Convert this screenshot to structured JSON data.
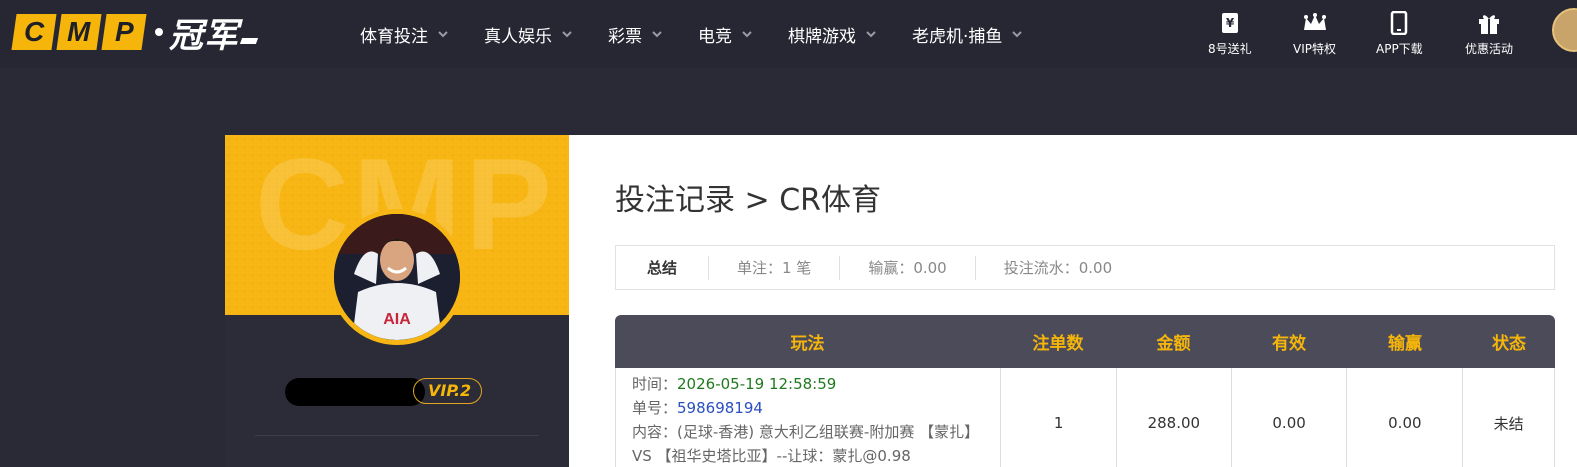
{
  "header": {
    "logo_letters": [
      "C",
      "M",
      "P"
    ],
    "logo_cn": "冠军",
    "nav": [
      {
        "label": "体育投注"
      },
      {
        "label": "真人娱乐"
      },
      {
        "label": "彩票"
      },
      {
        "label": "电竞"
      },
      {
        "label": "棋牌游戏"
      },
      {
        "label": "老虎机·捕鱼"
      }
    ],
    "quick_links": [
      {
        "label": "8号送礼",
        "icon": "yen-gift-icon"
      },
      {
        "label": "VIP特权",
        "icon": "crown-icon"
      },
      {
        "label": "APP下载",
        "icon": "phone-icon"
      },
      {
        "label": "优惠活动",
        "icon": "gift-box-icon"
      }
    ]
  },
  "profile": {
    "watermark": "CMP",
    "vip_label": "VIP.2"
  },
  "page": {
    "title": "投注记录 > CR体育"
  },
  "summary": {
    "label": "总结",
    "single": "单注：1 笔",
    "winloss": "输赢：0.00",
    "turnover": "投注流水：0.00"
  },
  "table": {
    "headers": [
      "玩法",
      "注单数",
      "金额",
      "有效",
      "输赢",
      "状态"
    ],
    "rows": [
      {
        "time_label": "时间：",
        "time": "2026-05-19 12:58:59",
        "order_label": "单号：",
        "order": "598698194",
        "content_label": "内容：",
        "content": "(足球-香港) 意大利乙组联赛-附加赛 【蒙扎】 VS 【祖华史塔比亚】--让球：蒙扎@0.98",
        "count": "1",
        "amount": "288.00",
        "valid": "0.00",
        "winloss": "0.00",
        "status": "未结"
      }
    ]
  },
  "colors": {
    "accent": "#f5b50a",
    "header_bg": "#262733",
    "table_head_bg": "#4b4b5a"
  }
}
